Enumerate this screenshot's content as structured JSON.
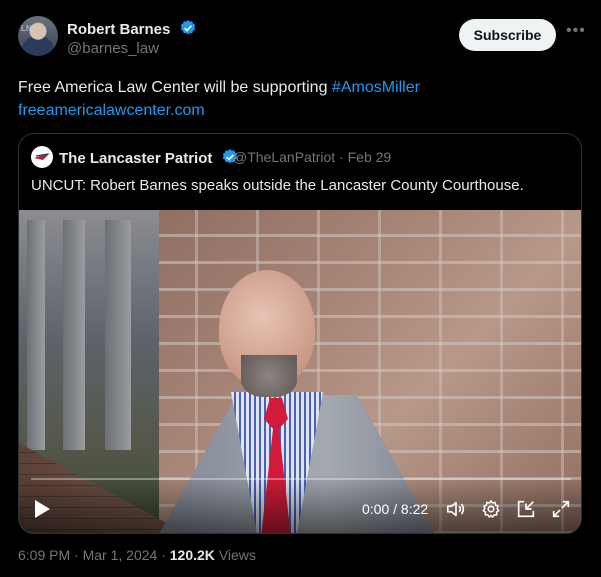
{
  "author": {
    "name": "Robert Barnes",
    "handle": "@barnes_law"
  },
  "subscribe_label": "Subscribe",
  "tweet": {
    "text_prefix": "Free America Law Center will be supporting ",
    "hashtag": "#AmosMiller",
    "link": "freeamericalawcenter.com"
  },
  "quote": {
    "name": "The Lancaster Patriot",
    "handle": "@TheLanPatriot",
    "separator": "·",
    "date": "Feb 29",
    "text": "UNCUT: Robert Barnes speaks outside the Lancaster County Courthouse."
  },
  "video": {
    "current_time": "0:00",
    "duration": "8:22",
    "time_separator": " / ",
    "progress_fraction": 0.0
  },
  "footer": {
    "time": "6:09 PM",
    "dot": "·",
    "date": "Mar 1, 2024",
    "views_count": "120.2K",
    "views_label": "Views"
  },
  "colors": {
    "accent": "#1d9bf0",
    "background": "#000000",
    "muted": "#71767b",
    "text": "#e7e9ea"
  }
}
